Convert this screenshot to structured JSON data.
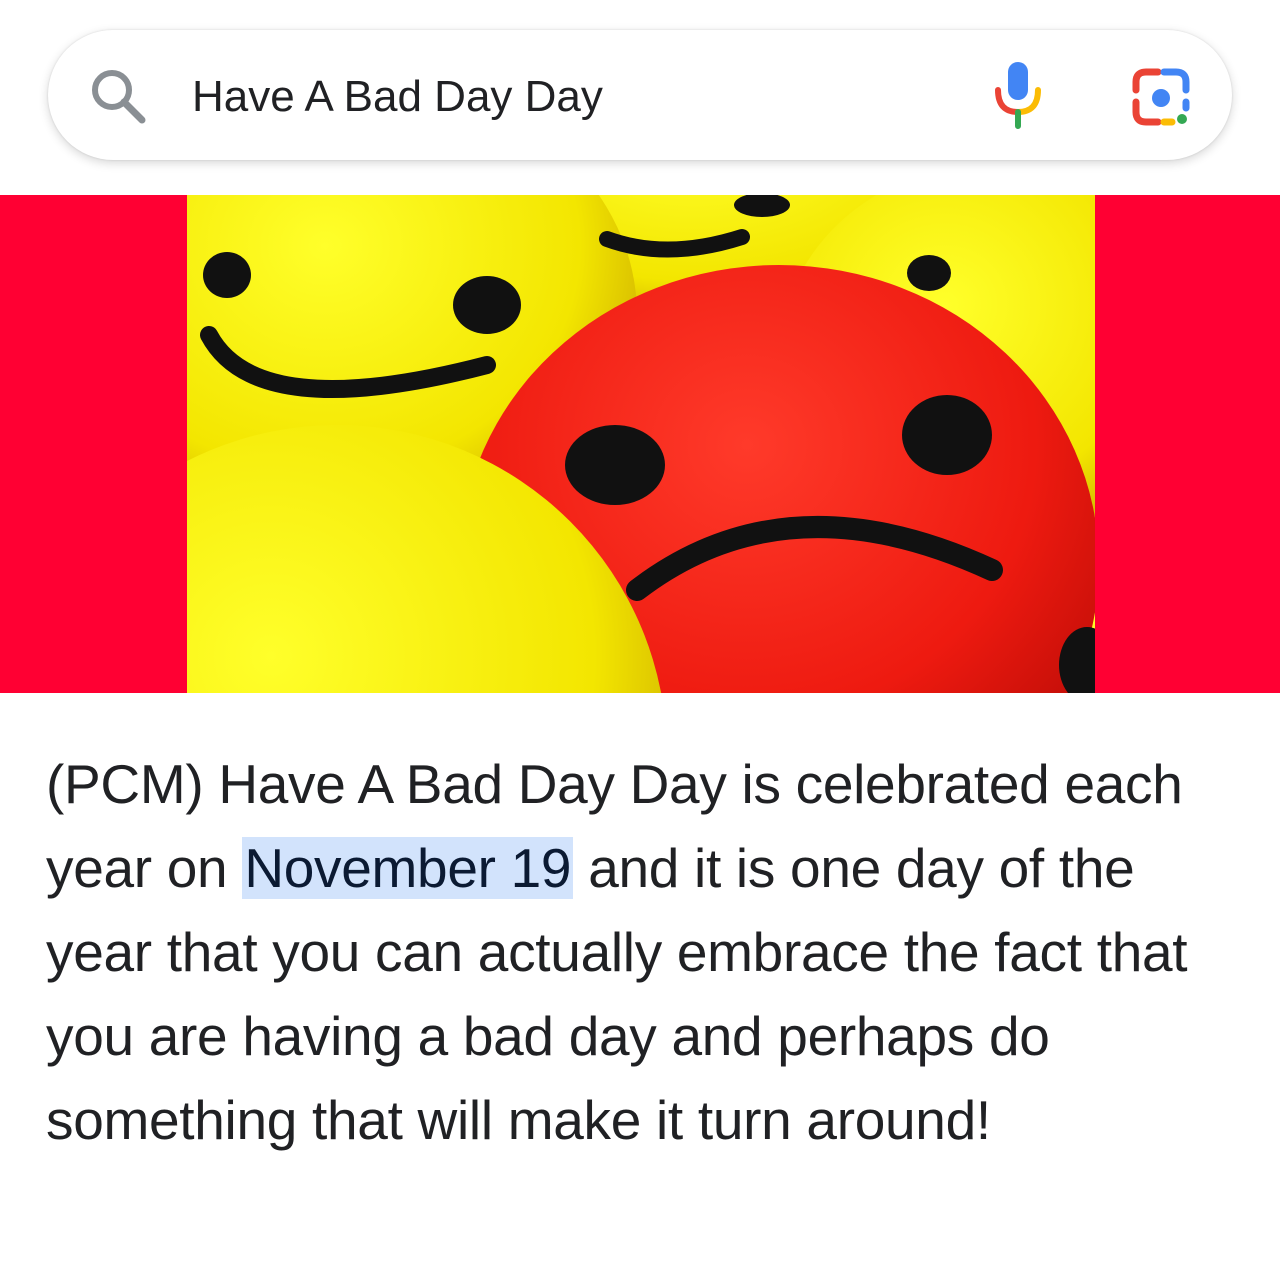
{
  "search": {
    "query": "Have A Bad Day Day",
    "icons": {
      "search": "search-icon",
      "voice": "microphone-icon",
      "lens": "google-lens-icon"
    }
  },
  "image": {
    "description_icon": "emoji-balls-image",
    "colors": {
      "band": "#ff0033",
      "yellow": "#f7e600",
      "red": "#ee1111"
    }
  },
  "snippet": {
    "before": "(PCM) Have A Bad Day Day is celebrated each year on ",
    "highlight": "November 19",
    "after": " and it is one day of the year that you can actually embrace the fact that you are having a bad day and perhaps do something that will make it turn around!"
  },
  "colors": {
    "highlight": "#d2e3fc",
    "text": "#202124"
  }
}
